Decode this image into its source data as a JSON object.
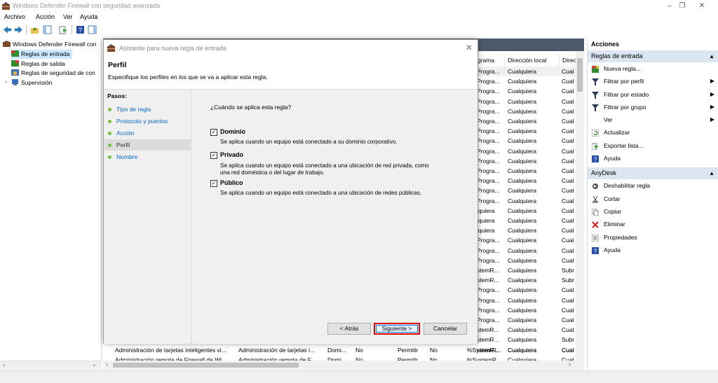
{
  "window": {
    "title": "Windows Defender Firewall con seguridad avanzada",
    "minimize": "–",
    "restore": "❐",
    "close": "✕"
  },
  "menu": [
    "Archivo",
    "Acción",
    "Ver",
    "Ayuda"
  ],
  "tree": {
    "root": "Windows Defender Firewall con",
    "items": [
      "Reglas de entrada",
      "Reglas de salida",
      "Reglas de seguridad de con",
      "Supervisión"
    ]
  },
  "list": {
    "columns": [
      "grama",
      "Dirección local",
      "Direc"
    ],
    "col0_values": [
      "Progra...",
      "Progra...",
      "Progra...",
      "Progra...",
      "Progra...",
      "Progra...",
      "Progra...",
      "Progra...",
      "Progra...",
      "Progra...",
      "Progra...",
      "Progra...",
      "Progra...",
      "Progra...",
      "lquiera",
      "lquiera",
      "lquiera",
      "Progra...",
      "Progra...",
      "Progra...",
      "stemR...",
      "stemR...",
      "Progra...",
      "Progra...",
      "Progra...",
      "Progra...",
      "stemR...",
      "stemR...",
      "stemR..."
    ],
    "col1_values": [
      "Cualquiera",
      "Cualquiera",
      "Cualquiera",
      "Cualquiera",
      "Cualquiera",
      "Cualquiera",
      "Cualquiera",
      "Cualquiera",
      "Cualquiera",
      "Cualquiera",
      "Cualquiera",
      "Cualquiera",
      "Cualquiera",
      "Cualquiera",
      "Cualquiera",
      "Cualquiera",
      "Cualquiera",
      "Cualquiera",
      "Cualquiera",
      "Cualquiera",
      "Cualquiera",
      "Cualquiera",
      "Cualquiera",
      "Cualquiera",
      "Cualquiera",
      "Cualquiera",
      "Cualquiera",
      "Cualquiera",
      "Cualquiera"
    ],
    "col2_values": [
      "Cual",
      "Cual",
      "Cual",
      "Cual",
      "Cual",
      "Cual",
      "Cual",
      "Cual",
      "Cual",
      "Cual",
      "Cual",
      "Cual",
      "Cual",
      "Cual",
      "Cual",
      "Cual",
      "Cual",
      "Cual",
      "Cual",
      "Cual",
      "Subr",
      "Subr",
      "Cual",
      "Cual",
      "Cual",
      "Cual",
      "Cual",
      "Subr",
      "Cual"
    ],
    "bottom_rows": [
      [
        "Administración de tarjetas inteligentes vi...",
        "Administración de tarjetas i...",
        "Domi...",
        "No",
        "Permitir",
        "No",
        "%SystemR...",
        "Cualquiera",
        "Cual"
      ],
      [
        "Administración remota de Firewall de Wi...",
        "Administración remota de F...",
        "Domi...",
        "No",
        "Permitir",
        "No",
        "%SystemR...",
        "Cualquiera",
        "Cual"
      ]
    ]
  },
  "actions": {
    "header": "Acciones",
    "section1": "Reglas de entrada",
    "items1": [
      "Nueva regla...",
      "Filtrar por perfil",
      "Filtrar por estado",
      "Filtrar por grupo",
      "Ver",
      "Actualizar",
      "Exportar lista...",
      "Ayuda"
    ],
    "section2": "AnyDesk",
    "items2": [
      "Deshabilitar regla",
      "Cortar",
      "Copiar",
      "Eliminar",
      "Propiedades",
      "Ayuda"
    ]
  },
  "dialog": {
    "title": "Asistente para nueva regla de entrada",
    "heading": "Perfil",
    "description": "Especifique los perfiles en los que se va a aplicar esta regla.",
    "steps_label": "Pasos:",
    "steps": [
      "Tipo de regla",
      "Protocolo y puertos",
      "Acción",
      "Perfil",
      "Nombre"
    ],
    "question": "¿Cuándo se aplica esta regla?",
    "options": [
      {
        "label": "Dominio",
        "desc": "Se aplica cuando un equipo está conectado a su dominio corporativo.",
        "check": "✓"
      },
      {
        "label": "Privado",
        "desc": "Se aplica cuando un equipo está conectado a una ubicación de red privada, como una red doméstica o del lugar de trabajo.",
        "check": "✓"
      },
      {
        "label": "Público",
        "desc": "Se aplica cuando un equipo está conectado a una ubicación de redes públicas.",
        "check": "✓"
      }
    ],
    "buttons": {
      "back": "< Atrás",
      "next": "Siguiente >",
      "cancel": "Cancelar"
    }
  },
  "colors": {
    "accent": "#0078d7",
    "highlight": "#e00000",
    "step_dot": "#6fbf3f"
  }
}
